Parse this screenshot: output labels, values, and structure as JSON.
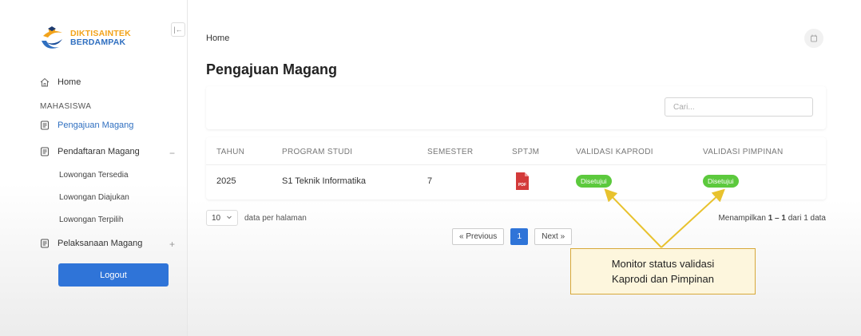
{
  "brand": {
    "line1": "DIKTISAINTEK",
    "line2": "BERDAMPAK"
  },
  "sidebar": {
    "collapse_icon": "collapse-sidebar-icon",
    "home_label": "Home",
    "section_label": "MAHASISWA",
    "items": [
      {
        "label": "Pengajuan Magang",
        "active": true
      },
      {
        "label": "Pendaftaran Magang",
        "toggle": "−",
        "children": [
          "Lowongan Tersedia",
          "Lowongan Diajukan",
          "Lowongan Terpilih"
        ]
      },
      {
        "label": "Pelaksanaan Magang",
        "toggle": "+"
      }
    ],
    "logout_label": "Logout"
  },
  "header": {
    "breadcrumb": "Home",
    "page_title": "Pengajuan Magang"
  },
  "search": {
    "placeholder": "Cari..."
  },
  "table": {
    "columns": [
      "TAHUN",
      "PROGRAM STUDI",
      "SEMESTER",
      "SPTJM",
      "VALIDASI KAPRODI",
      "VALIDASI PIMPINAN"
    ],
    "rows": [
      {
        "tahun": "2025",
        "program_studi": "S1 Teknik Informatika",
        "semester": "7",
        "sptjm_icon": "pdf-file-icon",
        "sptjm_label": "PDF",
        "validasi_kaprodi": "Disetujui",
        "validasi_pimpinan": "Disetujui"
      }
    ]
  },
  "footer": {
    "per_page_value": "10",
    "per_page_label": "data per halaman",
    "showing_prefix": "Menampilkan",
    "showing_range": "1 – 1",
    "showing_suffix": "dari 1 data",
    "prev_label": "« Previous",
    "current_page": "1",
    "next_label": "Next »"
  },
  "annotation": {
    "line1": "Monitor status validasi",
    "line2": "Kaprodi dan Pimpinan"
  },
  "colors": {
    "primary": "#2f74d8",
    "success": "#5cc93d",
    "brand_orange": "#f2a31b",
    "callout_border": "#d7a83a",
    "arrow": "#e8c22e"
  }
}
